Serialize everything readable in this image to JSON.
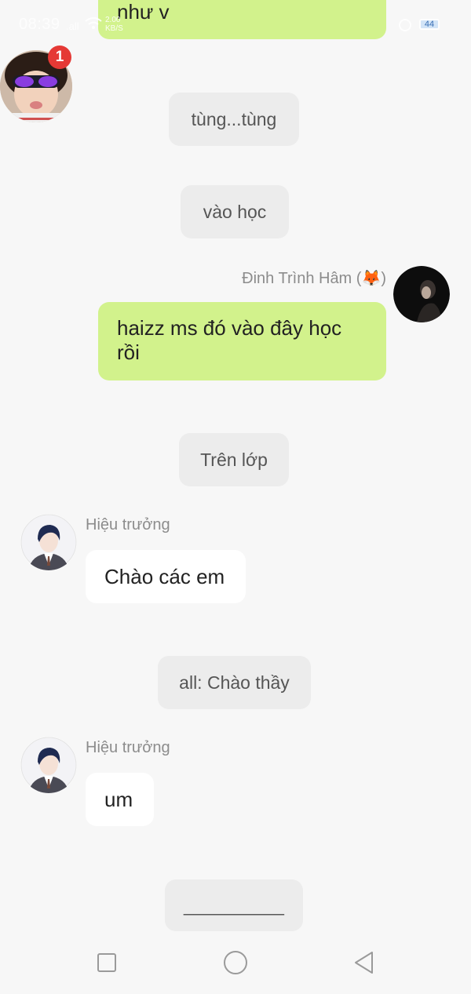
{
  "status_bar": {
    "time": "08:39",
    "signal": ".all",
    "speed_value": "2.00",
    "speed_unit": "KB/S",
    "battery": "44"
  },
  "floating_chat_head": {
    "badge_count": "1"
  },
  "messages": {
    "top_partial": "như v",
    "scene_1": "tùng...tùng",
    "scene_2": "vào học",
    "user_sender": "Đinh Trình Hâm (🦊)",
    "user_message": "haizz ms đó vào đây học rồi",
    "scene_3": "Trên lớp",
    "principal_name_1": "Hiệu trưởng",
    "principal_message_1": "Chào các em",
    "scene_4": "all: Chào thầy",
    "principal_name_2": "Hiệu trưởng",
    "principal_message_2": "um",
    "input_pill": "__________"
  },
  "colors": {
    "green_bubble": "#d2f28c",
    "pill_bg": "#ececec",
    "badge": "#e53935"
  }
}
